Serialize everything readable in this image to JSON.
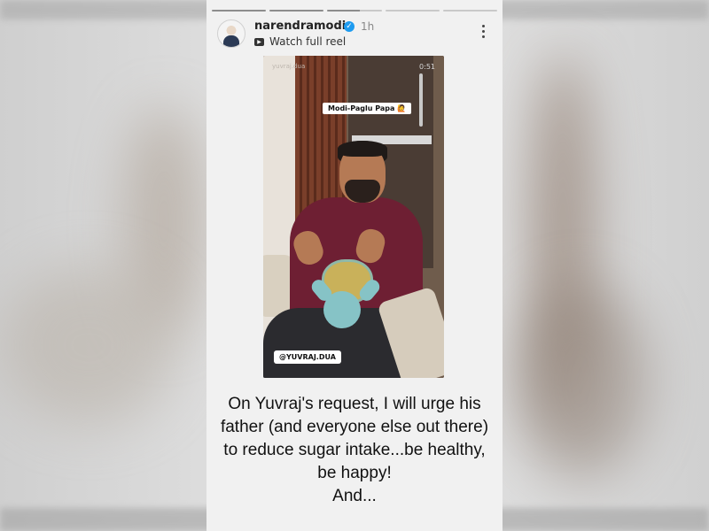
{
  "story": {
    "username": "narendramodi",
    "time": "1h",
    "watch_label": "Watch full reel",
    "progress": {
      "segments": 5,
      "completed": 2,
      "active_fraction": 0.6
    }
  },
  "video": {
    "tag": "Modi-Paglu Papa 🙋",
    "watermark": "yuvraj.dua",
    "time": "0:51",
    "handle": "@YUVRAJ.DUA"
  },
  "caption": {
    "text": "On Yuvraj's request, I will urge his father (and everyone else out there) to reduce sugar intake...be healthy, be happy!",
    "continuation": "And..."
  },
  "icons": {
    "verified": "verified-badge-icon",
    "reel": "reel-icon",
    "more": "more-options-icon"
  },
  "colors": {
    "verified": "#1d9bf0",
    "shirt": "#6e1f33"
  }
}
